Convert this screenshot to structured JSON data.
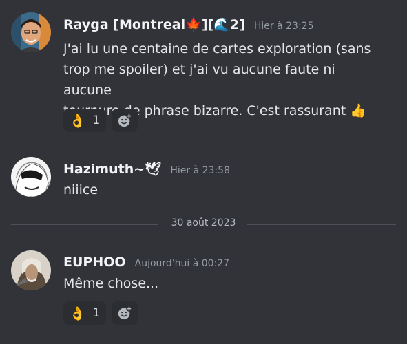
{
  "messages": [
    {
      "username": "Rayga [Montreal",
      "username_flag": "🍁",
      "username_mid": "][",
      "username_wave": "🌊",
      "username_end": "2]",
      "timestamp": "Hier à 23:25",
      "lines": [
        "J'ai lu une centaine de cartes exploration (sans",
        "trop me spoiler) et j'ai vu aucune faute ni aucune",
        "tournure de phrase bizarre. C'est rassurant"
      ],
      "trailing_emoji": "👍",
      "reaction": {
        "emoji": "👌",
        "count": "1"
      }
    },
    {
      "username": "Hazimuth~",
      "username_emoji": "🕊",
      "timestamp": "Hier à 23:58",
      "text": "niiice"
    },
    {
      "username": "EUPHOO",
      "timestamp": "Aujourd'hui à 00:27",
      "text": "Même chose...",
      "reaction": {
        "emoji": "👌",
        "count": "1"
      }
    }
  ],
  "date_divider": "30 août 2023",
  "icons": {
    "add_reaction": "add-reaction-icon"
  }
}
